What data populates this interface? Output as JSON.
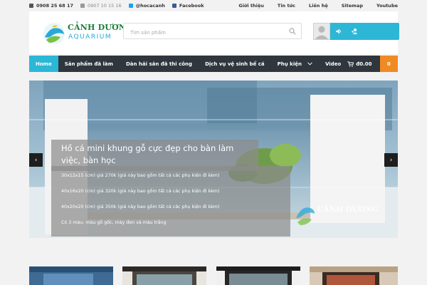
{
  "topbar": {
    "phone1": "0908 25 68 17",
    "phone2": "0907 10 15 16",
    "twitter": "@hocacanh",
    "facebook": "Facebook",
    "links": [
      "Giới thiệu",
      "Tin tức",
      "Liên hệ",
      "Sitemap",
      "Youtube"
    ]
  },
  "header": {
    "logo_title": "CẢNH DƯƠNG",
    "logo_subtitle": "AQUARIUM",
    "search_placeholder": "Tìm sản phẩm"
  },
  "nav": {
    "items": [
      "Home",
      "Sản phẩm đã làm",
      "Dàn hải sản đã thi công",
      "Dịch vụ vệ sinh bể cá",
      "Phụ kiện",
      "Video"
    ],
    "cart_total": "đ0.00",
    "cart_count": "0"
  },
  "slide": {
    "title": "Hồ cá mini khung gỗ cực đẹp cho bàn làm việc, bàn học",
    "lines": [
      "30x12x15 (cm) giá 270k (giá này bao gồm tất cả các phụ kiện đi kèm)",
      "40x16x20 (cm) giá 320k (giá này bao gồm tất cả các phụ kiện đi kèm)",
      "40x20x20 (cm) giá 350k (giá này bao gồm tất cả các phụ kiện đi kèm)",
      "Có 3 màu: màu gỗ gốc, mày đen và màu trắng"
    ],
    "watermark": "CẢNH DƯƠNG",
    "prev": "‹",
    "next": "›"
  },
  "colors": {
    "accent": "#2cb7d6",
    "nav_bg": "#2f363d",
    "cart_badge": "#f08a24"
  },
  "icons": [
    "phone-icon",
    "phone-muted-icon",
    "twitter-icon",
    "facebook-icon",
    "search-icon",
    "user-avatar-icon",
    "volume-icon",
    "users-icon",
    "cart-icon",
    "chevron-down-icon"
  ]
}
